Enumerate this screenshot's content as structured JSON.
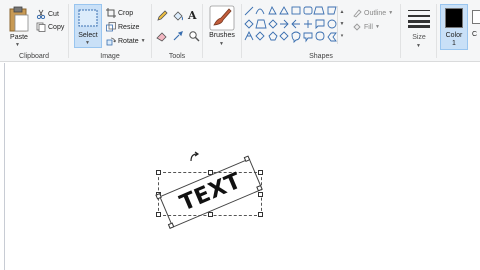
{
  "clipboard": {
    "paste_label": "Paste",
    "cut_label": "Cut",
    "copy_label": "Copy",
    "group_label": "Clipboard"
  },
  "image": {
    "select_label": "Select",
    "crop_label": "Crop",
    "resize_label": "Resize",
    "rotate_label": "Rotate",
    "group_label": "Image"
  },
  "tools": {
    "group_label": "Tools",
    "text_tool_glyph": "A"
  },
  "brushes": {
    "label": "Brushes"
  },
  "shapes": {
    "group_label": "Shapes",
    "outline_label": "Outline",
    "fill_label": "Fill"
  },
  "size": {
    "label": "Size"
  },
  "colors": {
    "color1_label": "Color",
    "color1_number": "1",
    "color1_value": "#000000",
    "color2_label": "C",
    "accent": "#c9e0f7"
  },
  "canvas": {
    "selected_text": "TEXT"
  }
}
